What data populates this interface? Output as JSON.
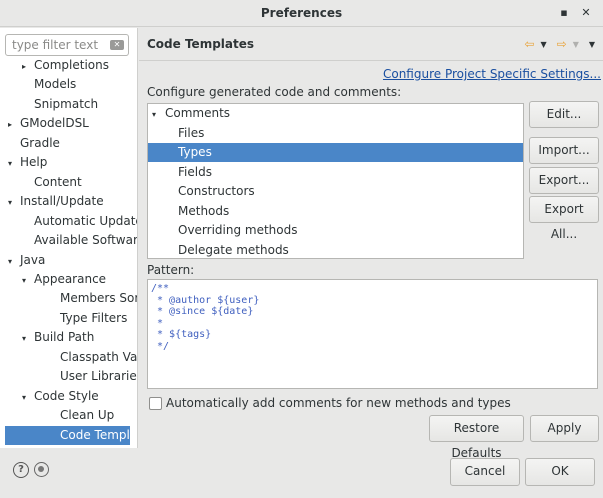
{
  "window": {
    "title": "Preferences",
    "min_glyph": "▪",
    "close_glyph": "✕"
  },
  "filter": {
    "placeholder": "type filter text"
  },
  "tree_items": [
    {
      "label": "Completions",
      "arrow": "▸",
      "level": 2
    },
    {
      "label": "Models",
      "arrow": "",
      "level": 2
    },
    {
      "label": "Snipmatch",
      "arrow": "",
      "level": 2
    },
    {
      "label": "GModelDSL",
      "arrow": "▸",
      "level": 1
    },
    {
      "label": "Gradle",
      "arrow": "",
      "level": 1
    },
    {
      "label": "Help",
      "arrow": "▾",
      "level": 1
    },
    {
      "label": "Content",
      "arrow": "",
      "level": 2
    },
    {
      "label": "Install/Update",
      "arrow": "▾",
      "level": 1
    },
    {
      "label": "Automatic Updates",
      "arrow": "",
      "level": 2
    },
    {
      "label": "Available Software S",
      "arrow": "",
      "level": 2
    },
    {
      "label": "Java",
      "arrow": "▾",
      "level": 1
    },
    {
      "label": "Appearance",
      "arrow": "▾",
      "level": 2
    },
    {
      "label": "Members Sort Or",
      "arrow": "",
      "level": 3
    },
    {
      "label": "Type Filters",
      "arrow": "",
      "level": 3
    },
    {
      "label": "Build Path",
      "arrow": "▾",
      "level": 2
    },
    {
      "label": "Classpath Variabl",
      "arrow": "",
      "level": 3
    },
    {
      "label": "User Libraries",
      "arrow": "",
      "level": 3
    },
    {
      "label": "Code Style",
      "arrow": "▾",
      "level": 2
    },
    {
      "label": "Clean Up",
      "arrow": "",
      "level": 3
    },
    {
      "label": "Code Templates",
      "arrow": "",
      "level": 3,
      "selected": true
    }
  ],
  "page": {
    "title": "Code Templates",
    "configure_link": "Configure Project Specific Settings...",
    "description": "Configure generated code and comments:",
    "pattern_label": "Pattern:",
    "pattern_text": "/**\n * @author ${user}\n * @since ${date}\n *\n * ${tags}\n */",
    "auto_comment_label": "Automatically add comments for new methods and types",
    "auto_comment_checked": false
  },
  "template_tree": [
    {
      "label": "Comments",
      "arrow": "▾",
      "level": 0
    },
    {
      "label": "Files",
      "arrow": "",
      "level": 1
    },
    {
      "label": "Types",
      "arrow": "",
      "level": 1,
      "selected": true
    },
    {
      "label": "Fields",
      "arrow": "",
      "level": 1
    },
    {
      "label": "Constructors",
      "arrow": "",
      "level": 1
    },
    {
      "label": "Methods",
      "arrow": "",
      "level": 1
    },
    {
      "label": "Overriding methods",
      "arrow": "",
      "level": 1
    },
    {
      "label": "Delegate methods",
      "arrow": "",
      "level": 1
    }
  ],
  "buttons": {
    "edit": "Edit...",
    "import": "Import...",
    "export": "Export...",
    "export_all": "Export All...",
    "restore_defaults": "Restore Defaults",
    "apply": "Apply",
    "cancel": "Cancel",
    "ok": "OK"
  },
  "nav": {
    "back_glyph": "⇦",
    "forward_glyph": "⇨",
    "dropdown_glyph": "▼"
  },
  "footer": {
    "help_glyph": "?"
  },
  "colors": {
    "selection": "#4a86c8",
    "link": "#1a4fa0",
    "nav_arrow": "#e8a33b",
    "javadoc": "#3f5fbf"
  }
}
